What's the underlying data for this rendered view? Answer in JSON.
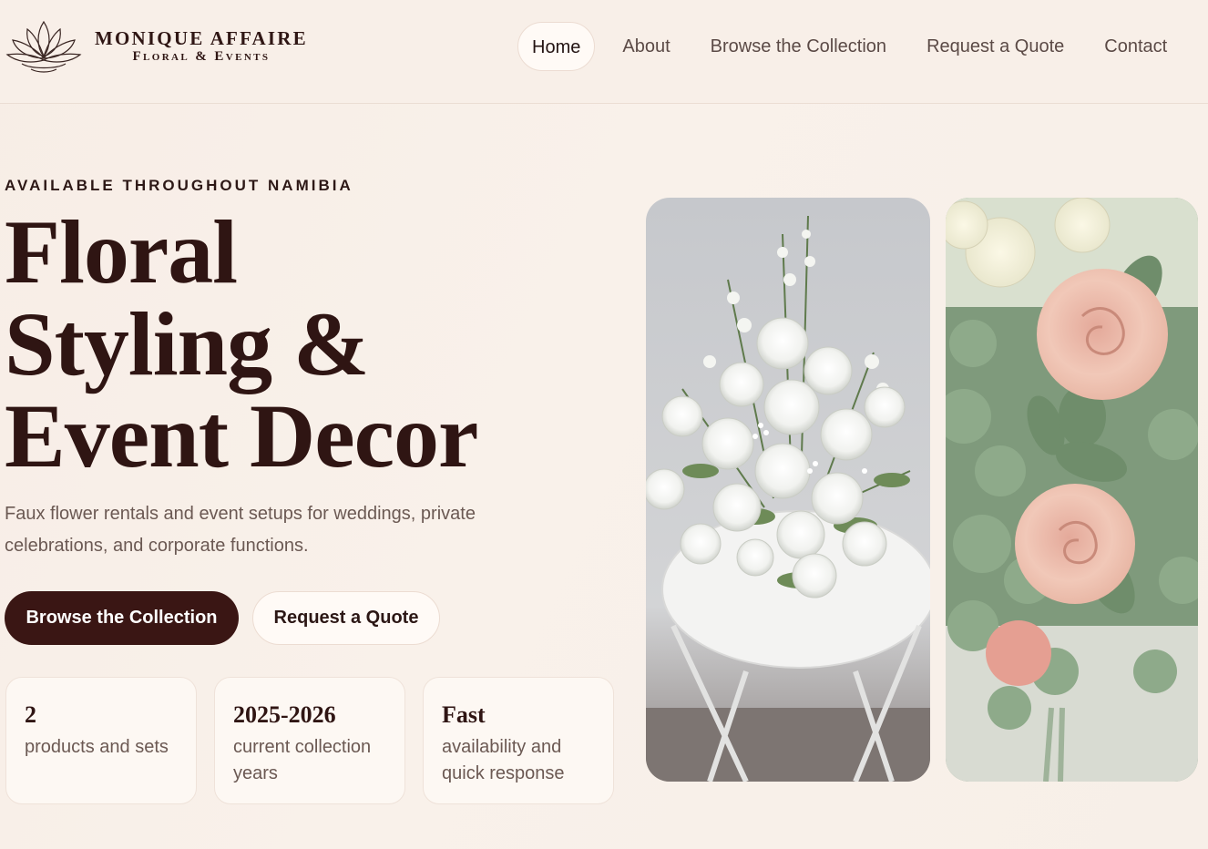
{
  "header": {
    "brand_name": "MONIQUE AFFAIRE",
    "brand_sub": "Floral & Events",
    "logo_icon": "lotus-icon",
    "nav": [
      {
        "label": "Home",
        "active": true
      },
      {
        "label": "About",
        "active": false
      },
      {
        "label": "Browse the Collection",
        "active": false
      },
      {
        "label": "Request a Quote",
        "active": false
      },
      {
        "label": "Contact",
        "active": false
      }
    ]
  },
  "hero": {
    "eyebrow": "AVAILABLE THROUGHOUT NAMIBIA",
    "headline": [
      "Floral",
      "Styling &",
      "Event Decor"
    ],
    "lede": "Faux flower rentals and event setups for weddings, private celebrations, and corporate functions.",
    "primary_cta": "Browse the Collection",
    "secondary_cta": "Request a Quote"
  },
  "stats": [
    {
      "value": "2",
      "label": "products and sets"
    },
    {
      "value": "2025-2026",
      "label": "current collection years"
    },
    {
      "value": "Fast",
      "label": "availability and quick response"
    }
  ],
  "colors": {
    "background": "#f8efe8",
    "primary": "#3a1614",
    "text": "#2f1513",
    "muted": "#6b5953"
  }
}
